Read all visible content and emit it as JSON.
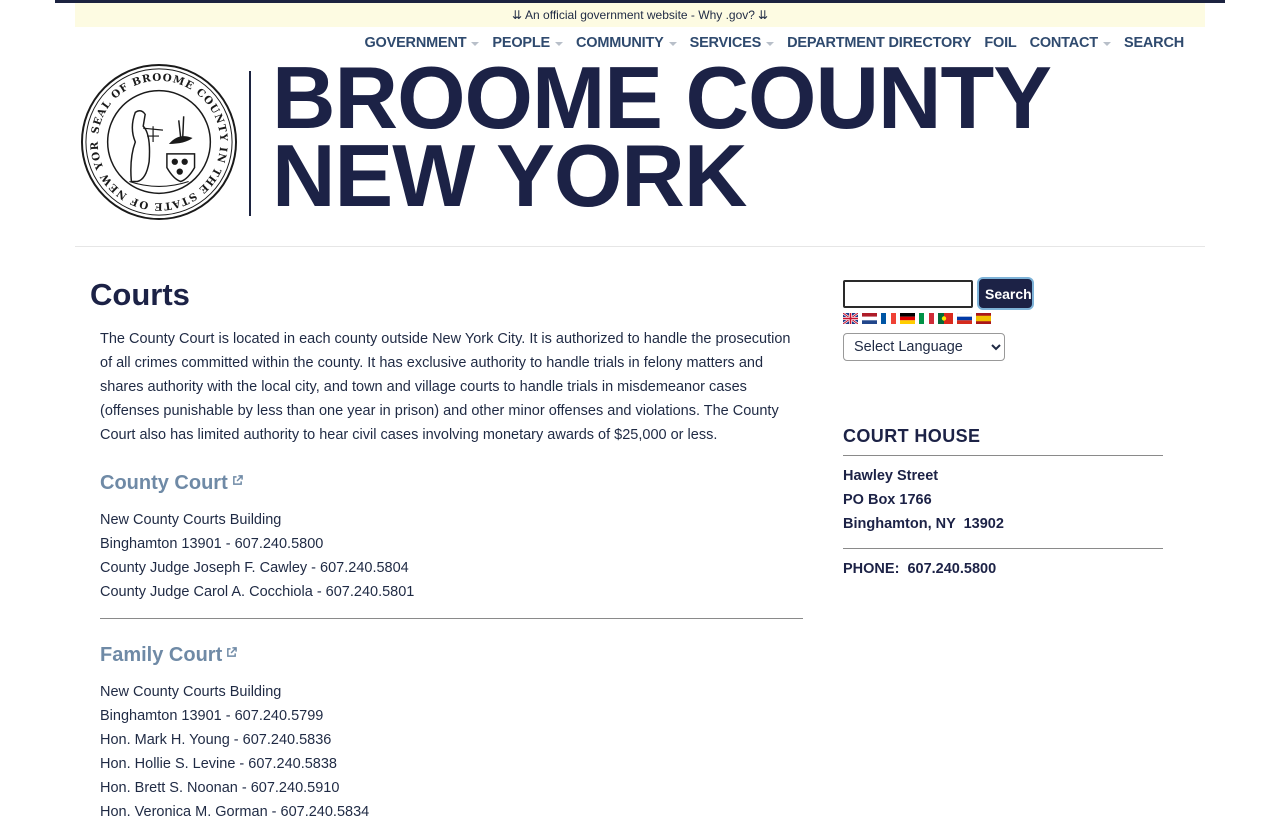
{
  "gov_banner": {
    "arrow_left": "⇊",
    "text": "An official government website - Why .gov?",
    "arrow_right": "⇊"
  },
  "nav": {
    "items": [
      {
        "label": "GOVERNMENT",
        "dropdown": true
      },
      {
        "label": "PEOPLE",
        "dropdown": true
      },
      {
        "label": "COMMUNITY",
        "dropdown": true
      },
      {
        "label": "SERVICES",
        "dropdown": true
      },
      {
        "label": "DEPARTMENT DIRECTORY",
        "dropdown": false
      },
      {
        "label": "FOIL",
        "dropdown": false
      },
      {
        "label": "CONTACT",
        "dropdown": true
      },
      {
        "label": "SEARCH",
        "dropdown": false
      }
    ]
  },
  "header": {
    "seal_icon": "broome-county-seal",
    "logo_line1": "BROOME COUNTY",
    "logo_line2": "NEW YORK",
    "seal_text": "SEAL OF BROOME COUNTY IN THE STATE OF NEW YORK"
  },
  "main": {
    "title": "Courts",
    "intro": "The County Court is located in each county outside New York City. It is authorized to handle the prosecution of all crimes committed within the county. It has exclusive authority to handle trials in felony matters and shares authority with the local city, and town and village courts to handle trials in misdemeanor cases (offenses punishable by less than one year in prison) and other minor offenses and violations. The County Court also has limited authority to hear civil cases involving monetary awards of $25,000 or less.",
    "sections": [
      {
        "heading": "County Court",
        "lines": [
          "New County Courts Building",
          "Binghamton 13901 - 607.240.5800",
          "County Judge Joseph F. Cawley - 607.240.5804",
          "County Judge Carol A. Cocchiola - 607.240.5801"
        ]
      },
      {
        "heading": "Family Court",
        "lines": [
          "New County Courts Building",
          "Binghamton 13901 - 607.240.5799",
          "Hon. Mark H. Young - 607.240.5836",
          "Hon. Hollie S. Levine - 607.240.5838",
          "Hon. Brett S. Noonan - 607.240.5910",
          "Hon. Veronica M. Gorman - 607.240.5834"
        ]
      }
    ]
  },
  "sidebar": {
    "search_value": "",
    "search_button": "Search",
    "flags": [
      "flag-en",
      "flag-nl",
      "flag-fr",
      "flag-de",
      "flag-it",
      "flag-pt",
      "flag-ru",
      "flag-es"
    ],
    "language_select": "Select Language",
    "court_house": {
      "heading": "COURT HOUSE",
      "address": [
        "Hawley Street",
        "PO Box 1766",
        "Binghamton, NY  13902"
      ],
      "phone": "PHONE:  607.240.5800"
    }
  },
  "colors": {
    "brand_navy": "#1c2246",
    "nav_text": "#2f4a6e",
    "section_link": "#6f8aa6",
    "banner_bg": "#fdfbe2"
  }
}
